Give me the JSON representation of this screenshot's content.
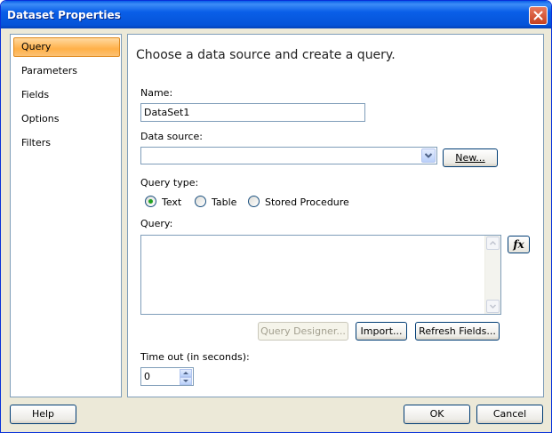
{
  "window": {
    "title": "Dataset Properties"
  },
  "nav": {
    "items": [
      {
        "label": "Query",
        "selected": true
      },
      {
        "label": "Parameters",
        "selected": false
      },
      {
        "label": "Fields",
        "selected": false
      },
      {
        "label": "Options",
        "selected": false
      },
      {
        "label": "Filters",
        "selected": false
      }
    ]
  },
  "panel": {
    "heading": "Choose a data source and create a query.",
    "name_label": "Name:",
    "name_value": "DataSet1",
    "data_source_label": "Data source:",
    "data_source_value": "",
    "new_button": "New...",
    "query_type_label": "Query type:",
    "query_types": [
      {
        "label": "Text",
        "checked": true
      },
      {
        "label": "Table",
        "checked": false
      },
      {
        "label": "Stored Procedure",
        "checked": false
      }
    ],
    "query_label": "Query:",
    "query_value": "",
    "fx_label": "fx",
    "query_designer_button": "Query Designer...",
    "import_button": "Import...",
    "refresh_fields_button": "Refresh Fields...",
    "timeout_label": "Time out (in seconds):",
    "timeout_value": "0"
  },
  "footer": {
    "help": "Help",
    "ok": "OK",
    "cancel": "Cancel"
  },
  "icons": {
    "close": "close-icon",
    "dropdown": "chevron-down-icon",
    "expression": "function-icon"
  },
  "colors": {
    "title_bar": "#0a5fe8",
    "selection": "#ffb048",
    "dialog_bg": "#ece9d8",
    "radio_dot": "#21a121"
  }
}
